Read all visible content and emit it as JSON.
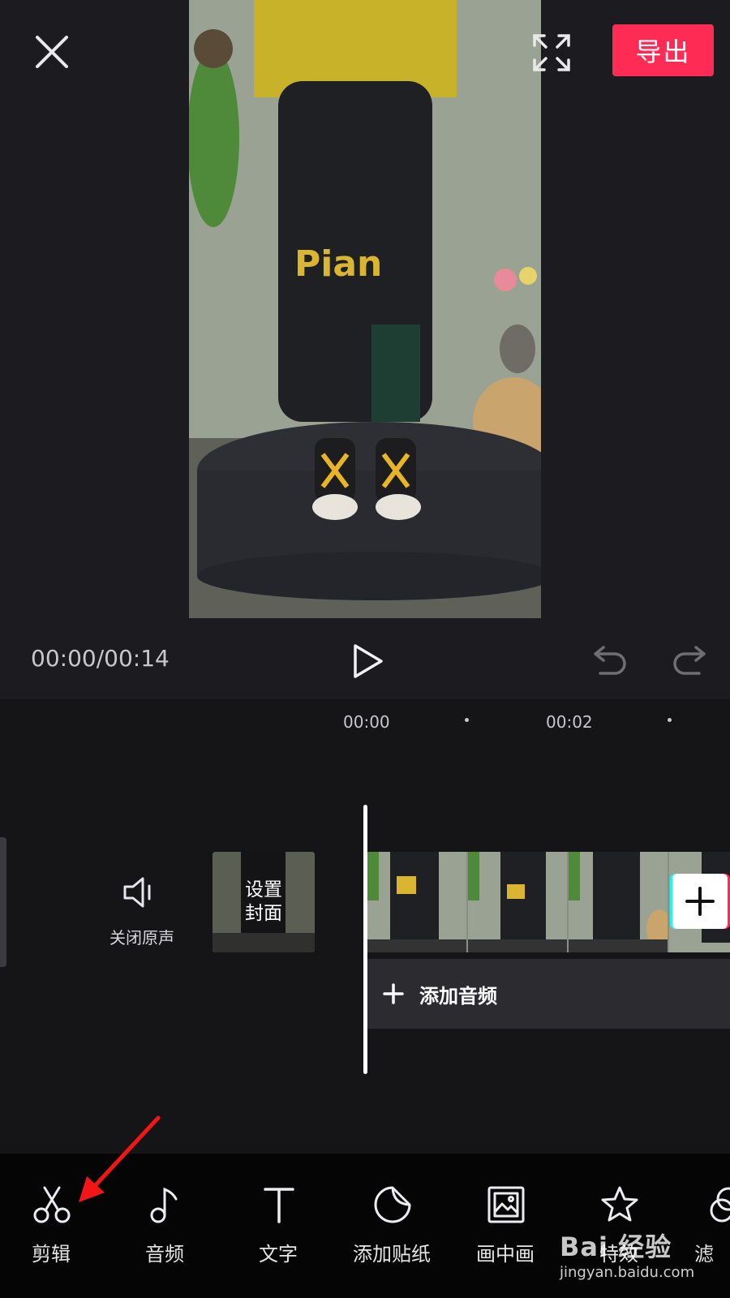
{
  "header": {
    "close_icon": "close-icon",
    "fullscreen_icon": "fullscreen-icon",
    "export_label": "导出",
    "accent_color": "#fe2c55"
  },
  "player": {
    "timecode": "00:00/00:14",
    "play_icon": "play-icon",
    "undo_icon": "undo-icon",
    "redo_icon": "redo-icon"
  },
  "timeline": {
    "ruler": [
      "00:00",
      "00:02"
    ],
    "mute_label": "关闭原声",
    "cover_label": "设置\n封面",
    "add_clip_icon": "plus-icon",
    "add_audio_label": "添加音频"
  },
  "toolbar": {
    "items": [
      {
        "label": "剪辑",
        "icon": "scissors-icon"
      },
      {
        "label": "音频",
        "icon": "music-note-icon"
      },
      {
        "label": "文字",
        "icon": "text-icon"
      },
      {
        "label": "添加贴纸",
        "icon": "sticker-icon"
      },
      {
        "label": "画中画",
        "icon": "picture-in-picture-icon"
      },
      {
        "label": "特效",
        "icon": "effects-star-icon"
      },
      {
        "label": "滤",
        "icon": "filter-icon"
      }
    ]
  },
  "watermark": {
    "logo": "Bai 经验",
    "url": "jingyan.baidu.com"
  }
}
